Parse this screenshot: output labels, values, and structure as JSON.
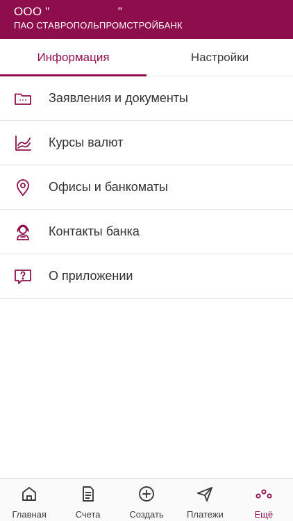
{
  "header": {
    "company": "ООО \"                    \"",
    "bank": "ПАО СТАВРОПОЛЬПРОМСТРОЙБАНК"
  },
  "tabs": [
    {
      "label": "Информация",
      "active": true
    },
    {
      "label": "Настройки",
      "active": false
    }
  ],
  "menu": [
    {
      "label": "Заявления и документы",
      "icon": "folder-icon"
    },
    {
      "label": "Курсы валют",
      "icon": "chart-icon"
    },
    {
      "label": "Офисы и банкоматы",
      "icon": "location-pin-icon"
    },
    {
      "label": "Контакты банка",
      "icon": "support-agent-icon"
    },
    {
      "label": "О приложении",
      "icon": "question-bubble-icon"
    }
  ],
  "bottom_nav": [
    {
      "label": "Главная",
      "icon": "home-icon",
      "active": false
    },
    {
      "label": "Счета",
      "icon": "document-icon",
      "active": false
    },
    {
      "label": "Создать",
      "icon": "plus-circle-icon",
      "active": false
    },
    {
      "label": "Платежи",
      "icon": "send-icon",
      "active": false
    },
    {
      "label": "Ещё",
      "icon": "more-dots-icon",
      "active": true
    }
  ],
  "colors": {
    "brand": "#8e0d4c",
    "text": "#333333",
    "divider": "#e3e3e3"
  }
}
